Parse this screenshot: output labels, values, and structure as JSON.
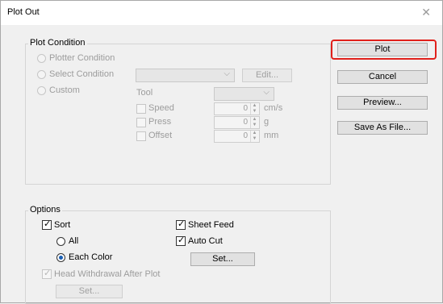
{
  "window": {
    "title": "Plot Out"
  },
  "plot_condition": {
    "group_label": "Plot Condition",
    "plotter_condition": "Plotter Condition",
    "select_condition": "Select Condition",
    "custom": "Custom",
    "edit_button": "Edit...",
    "tool_label": "Tool",
    "speed": {
      "label": "Speed",
      "value": "0",
      "unit": "cm/s"
    },
    "press": {
      "label": "Press",
      "value": "0",
      "unit": "g"
    },
    "offset": {
      "label": "Offset",
      "value": "0",
      "unit": "mm"
    }
  },
  "options": {
    "group_label": "Options",
    "sort": "Sort",
    "all": "All",
    "each_color": "Each Color",
    "sheet_feed": "Sheet Feed",
    "auto_cut": "Auto Cut",
    "set_button": "Set...",
    "head_withdrawal": "Head Withdrawal After Plot",
    "head_set_button": "Set..."
  },
  "buttons": {
    "plot": "Plot",
    "cancel": "Cancel",
    "preview": "Preview...",
    "save_as_file": "Save As File..."
  },
  "colors": {
    "highlight": "#e0201b"
  }
}
